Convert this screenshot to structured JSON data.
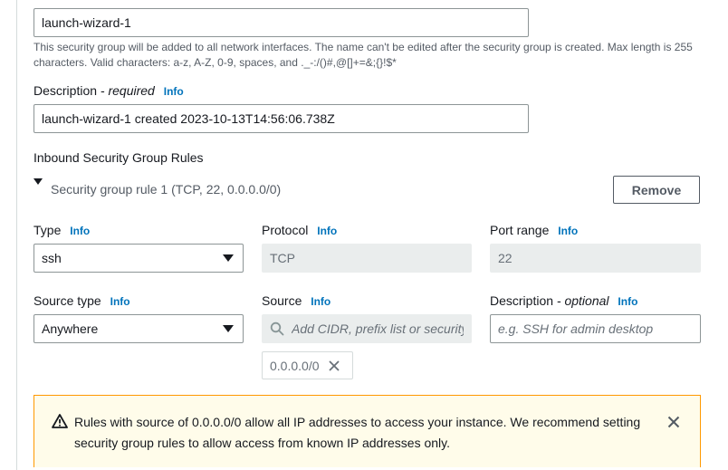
{
  "security_group": {
    "name_value": "launch-wizard-1",
    "name_hint": "This security group will be added to all network interfaces. The name can't be edited after the security group is created. Max length is 255 characters. Valid characters: a-z, A-Z, 0-9, spaces, and ._-:/()#,@[]+=&;{}!$*",
    "description_label": "Description",
    "description_required": "- required",
    "description_info": "Info",
    "description_value": "launch-wizard-1 created 2023-10-13T14:56:06.738Z"
  },
  "inbound": {
    "heading": "Inbound Security Group Rules",
    "rule_title": "Security group rule 1 (TCP, 22, 0.0.0.0/0)",
    "remove_label": "Remove",
    "type_label": "Type",
    "type_info": "Info",
    "type_value": "ssh",
    "protocol_label": "Protocol",
    "protocol_info": "Info",
    "protocol_value": "TCP",
    "port_label": "Port range",
    "port_info": "Info",
    "port_value": "22",
    "source_type_label": "Source type",
    "source_type_info": "Info",
    "source_type_value": "Anywhere",
    "source_label": "Source",
    "source_info": "Info",
    "source_placeholder": "Add CIDR, prefix list or security",
    "source_token": "0.0.0.0/0",
    "desc_label": "Description",
    "desc_optional": "- optional",
    "desc_info": "Info",
    "desc_placeholder": "e.g. SSH for admin desktop"
  },
  "warning": {
    "text": "Rules with source of 0.0.0.0/0 allow all IP addresses to access your instance. We recommend setting security group rules to allow access from known IP addresses only."
  },
  "colors": {
    "link": "#0073bb",
    "warning_border": "#ff9900",
    "warning_bg": "#fffcea"
  }
}
